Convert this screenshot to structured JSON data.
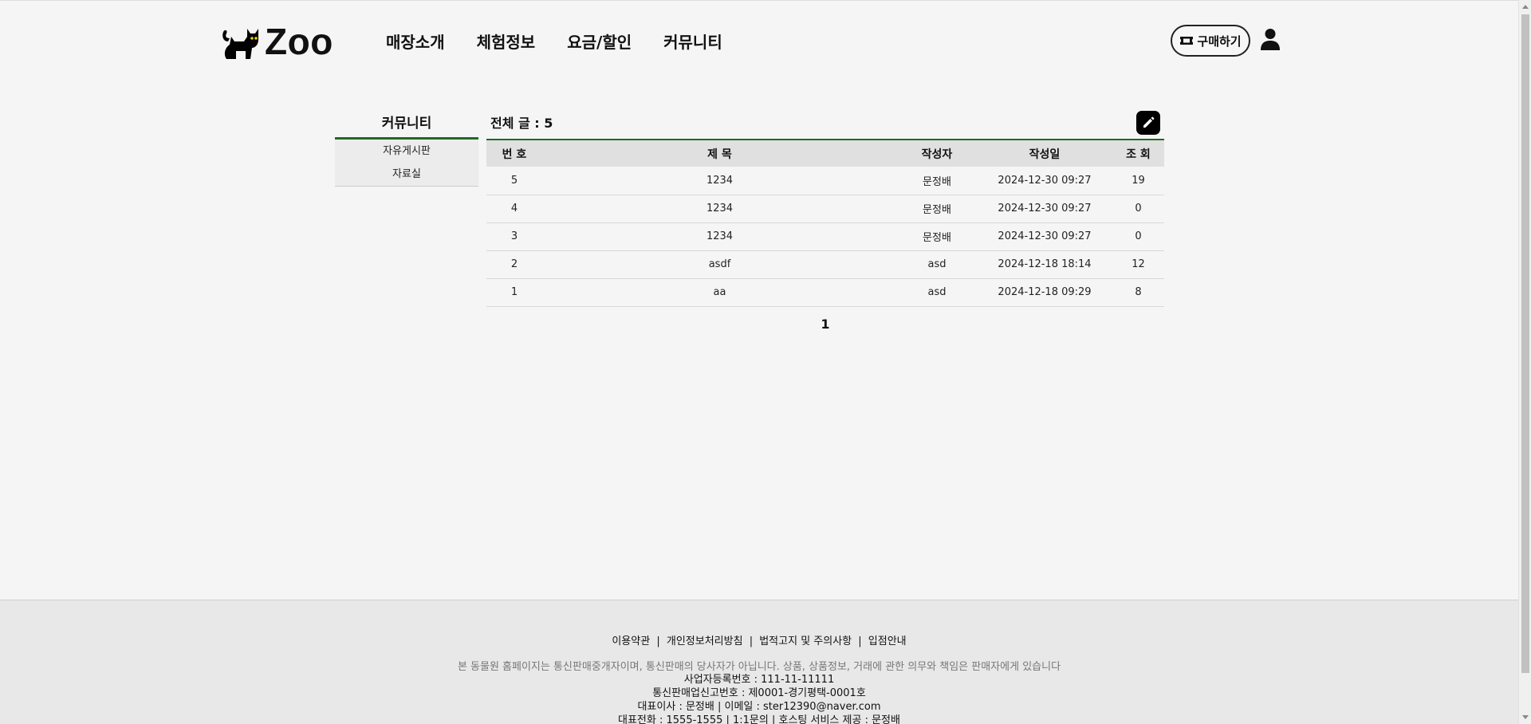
{
  "header": {
    "logo_text": "Zoo",
    "nav": [
      "매장소개",
      "체험정보",
      "요금/할인",
      "커뮤니티"
    ],
    "buy_label": "구매하기"
  },
  "sidebar": {
    "title": "커뮤니티",
    "items": [
      "자유게시판",
      "자료실"
    ]
  },
  "board": {
    "total_label": "전체 글 : 5",
    "columns": [
      "번 호",
      "제 목",
      "작성자",
      "작성일",
      "조 회"
    ],
    "rows": [
      {
        "no": "5",
        "title": "1234",
        "author": "문정배",
        "date": "2024-12-30 09:27",
        "views": "19"
      },
      {
        "no": "4",
        "title": "1234",
        "author": "문정배",
        "date": "2024-12-30 09:27",
        "views": "0"
      },
      {
        "no": "3",
        "title": "1234",
        "author": "문정배",
        "date": "2024-12-30 09:27",
        "views": "0"
      },
      {
        "no": "2",
        "title": "asdf",
        "author": "asd",
        "date": "2024-12-18 18:14",
        "views": "12"
      },
      {
        "no": "1",
        "title": "aa",
        "author": "asd",
        "date": "2024-12-18 09:29",
        "views": "8"
      }
    ],
    "page": "1"
  },
  "footer": {
    "links": [
      "이용약관",
      "개인정보처리방침",
      "법적고지 및 주의사항",
      "입점안내"
    ],
    "separator": "|",
    "desc": "본 동물원 홈페이지는 통신판매중개자이며, 통신판매의 당사자가 아닙니다. 상품, 상품정보, 거래에 관한 의무와 책임은 판매자에게 있습니다",
    "biz_no": "사업자등록번호 : 111-11-11111",
    "mail_order": "통신판매업신고번호 : 제0001-경기평택-0001호",
    "ceo": "대표이사 : 문정배 | 이메일 : ster12390@naver.com",
    "phone": "대표전화 : 1555-1555 | 1:1문의 | 호스팅 서비스 제공 : 문정배"
  },
  "colors": {
    "accent_green": "#1f6b25",
    "header_row": "#e0e0e0",
    "footer_bg": "#e8e8e8"
  }
}
